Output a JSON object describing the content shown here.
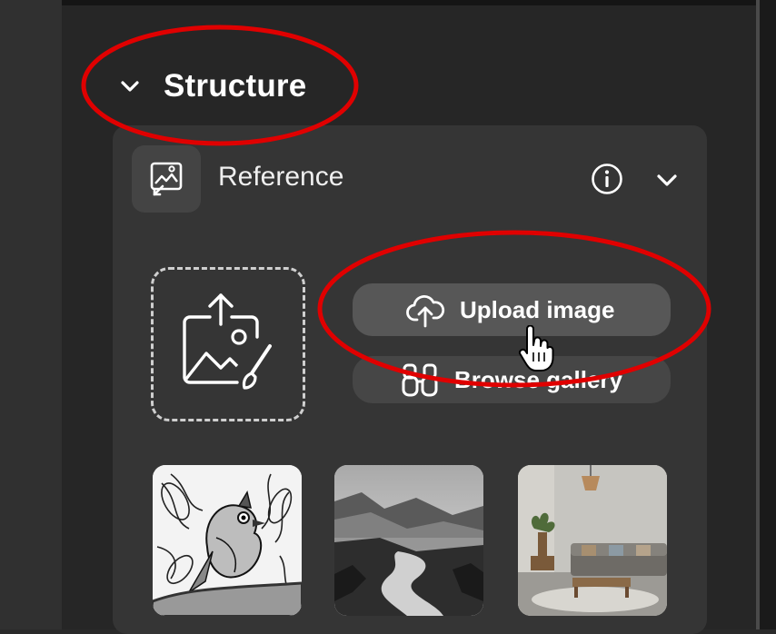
{
  "section": {
    "title": "Structure",
    "chevron_icon": "chevron-down-icon"
  },
  "reference": {
    "label": "Reference",
    "icon": "reference-image-icon",
    "info_icon": "info-icon",
    "chevron_icon": "chevron-down-icon"
  },
  "upload": {
    "dropzone_icon": "upload-image-icon",
    "upload_label": "Upload image",
    "upload_icon": "cloud-upload-icon",
    "browse_label": "Browse gallery",
    "browse_icon": "binoculars-icon"
  },
  "gallery": {
    "thumbnails": [
      "bird-sketch",
      "misty-valley",
      "living-room"
    ]
  },
  "colors": {
    "panel_bg": "#262626",
    "card_bg": "#353535",
    "button_bg": "#575757",
    "annotation": "#e00000"
  }
}
